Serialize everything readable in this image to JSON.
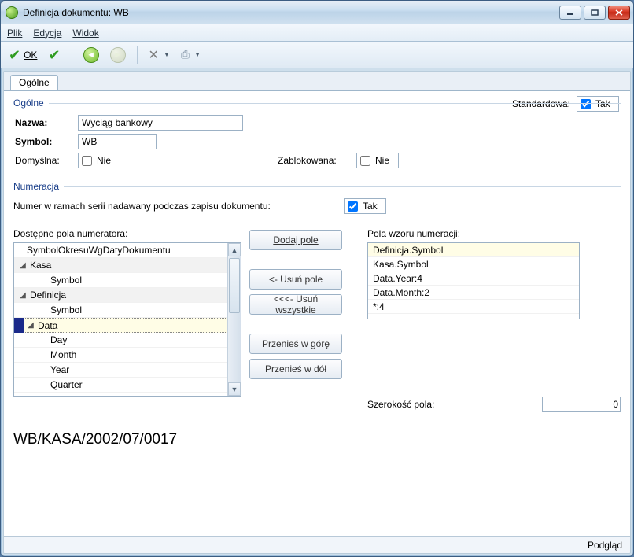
{
  "window": {
    "title": "Definicja dokumentu: WB"
  },
  "menu": {
    "file": "Plik",
    "edit": "Edycja",
    "view": "Widok"
  },
  "toolbar": {
    "ok": "OK"
  },
  "tabs": {
    "general": "Ogólne"
  },
  "group_general": {
    "legend": "Ogólne",
    "name_label": "Nazwa:",
    "name_value": "Wyciąg bankowy",
    "symbol_label": "Symbol:",
    "symbol_value": "WB",
    "default_label": "Domyślna:",
    "default_check_text": "Nie",
    "default_checked": false,
    "locked_label": "Zablokowana:",
    "locked_check_text": "Nie",
    "locked_checked": false,
    "standard_label": "Standardowa:",
    "standard_check_text": "Tak",
    "standard_checked": true
  },
  "group_numbering": {
    "legend": "Numeracja",
    "series_label": "Numer w ramach serii nadawany podczas zapisu dokumentu:",
    "series_check_text": "Tak",
    "series_checked": true
  },
  "left_list": {
    "label": "Dostępne pola numeratora:",
    "items": [
      {
        "text": "SymbolOkresuWgDatyDokumentu",
        "type": "item",
        "indent": 1
      },
      {
        "text": "Kasa",
        "type": "group",
        "indent": 0
      },
      {
        "text": "Symbol",
        "type": "item",
        "indent": 2
      },
      {
        "text": "Definicja",
        "type": "group",
        "indent": 0
      },
      {
        "text": "Symbol",
        "type": "item",
        "indent": 2
      },
      {
        "text": "Data",
        "type": "group",
        "indent": 0,
        "selected": true
      },
      {
        "text": "Day",
        "type": "item",
        "indent": 2
      },
      {
        "text": "Month",
        "type": "item",
        "indent": 2
      },
      {
        "text": "Year",
        "type": "item",
        "indent": 2
      },
      {
        "text": "Quarter",
        "type": "item",
        "indent": 2
      }
    ]
  },
  "mid_buttons": {
    "add": "Dodaj pole",
    "remove": "<- Usuń pole",
    "remove_all": "<<<- Usuń wszystkie",
    "move_up": "Przenieś w górę",
    "move_down": "Przenieś w dół"
  },
  "right_list": {
    "label": "Pola wzoru numeracji:",
    "items": [
      {
        "text": "Definicja.Symbol",
        "hl": true
      },
      {
        "text": "Kasa.Symbol"
      },
      {
        "text": "Data.Year:4"
      },
      {
        "text": "Data.Month:2"
      },
      {
        "text": "*:4"
      }
    ]
  },
  "width": {
    "label": "Szerokość pola:",
    "value": "0"
  },
  "preview": "WB/KASA/2002/07/0017",
  "statusbar": {
    "right": "Podgląd"
  }
}
